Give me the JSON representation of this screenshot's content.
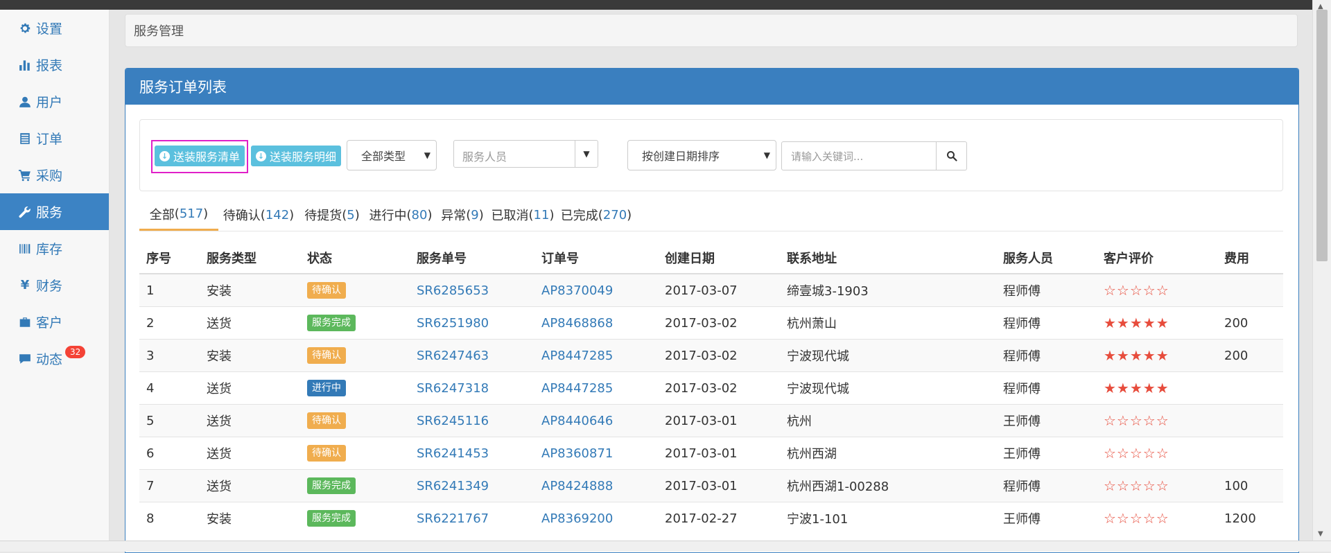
{
  "sidebar": {
    "items": [
      {
        "label": "设置",
        "icon": "gear-icon"
      },
      {
        "label": "报表",
        "icon": "bar-chart-icon"
      },
      {
        "label": "用户",
        "icon": "user-icon"
      },
      {
        "label": "订单",
        "icon": "list-icon"
      },
      {
        "label": "采购",
        "icon": "cart-icon"
      },
      {
        "label": "服务",
        "icon": "wrench-icon",
        "active": true
      },
      {
        "label": "库存",
        "icon": "barcode-icon"
      },
      {
        "label": "财务",
        "icon": "yen-icon"
      },
      {
        "label": "客户",
        "icon": "briefcase-icon"
      },
      {
        "label": "动态",
        "icon": "comment-icon",
        "badge": "32"
      }
    ]
  },
  "breadcrumb": {
    "text": "服务管理"
  },
  "panel": {
    "title": "服务订单列表"
  },
  "filters": {
    "btn_service_list": "送装服务清单",
    "btn_service_detail": "送装服务明细",
    "type_select": "全部类型",
    "staff_placeholder": "服务人员",
    "sort_select": "按创建日期排序",
    "keyword_placeholder": "请输入关键词..."
  },
  "tabs": [
    {
      "label": "全部",
      "count": "517",
      "active": true
    },
    {
      "label": "待确认",
      "count": "142"
    },
    {
      "label": "待提货",
      "count": "5"
    },
    {
      "label": "进行中",
      "count": "80"
    },
    {
      "label": "异常",
      "count": "9"
    },
    {
      "label": "已取消",
      "count": "11"
    },
    {
      "label": "已完成",
      "count": "270"
    }
  ],
  "table": {
    "headers": [
      "序号",
      "服务类型",
      "状态",
      "服务单号",
      "订单号",
      "创建日期",
      "联系地址",
      "服务人员",
      "客户评价",
      "费用"
    ],
    "rows": [
      {
        "no": "1",
        "type": "安装",
        "status": "待确认",
        "service_no": "SR6285653",
        "order_no": "AP8370049",
        "date": "2017-03-07",
        "address": "缔壹城3-1903",
        "staff": "程师傅",
        "rating": "☆☆☆☆☆",
        "fee": ""
      },
      {
        "no": "2",
        "type": "送货",
        "status": "服务完成",
        "service_no": "SR6251980",
        "order_no": "AP8468868",
        "date": "2017-03-02",
        "address": "杭州萧山",
        "staff": "程师傅",
        "rating": "★★★★★",
        "fee": "200"
      },
      {
        "no": "3",
        "type": "安装",
        "status": "待确认",
        "service_no": "SR6247463",
        "order_no": "AP8447285",
        "date": "2017-03-02",
        "address": "宁波现代城",
        "staff": "程师傅",
        "rating": "★★★★★",
        "fee": "200"
      },
      {
        "no": "4",
        "type": "送货",
        "status": "进行中",
        "service_no": "SR6247318",
        "order_no": "AP8447285",
        "date": "2017-03-02",
        "address": "宁波现代城",
        "staff": "程师傅",
        "rating": "★★★★★",
        "fee": ""
      },
      {
        "no": "5",
        "type": "送货",
        "status": "待确认",
        "service_no": "SR6245116",
        "order_no": "AP8440646",
        "date": "2017-03-01",
        "address": "杭州",
        "staff": "王师傅",
        "rating": "☆☆☆☆☆",
        "fee": ""
      },
      {
        "no": "6",
        "type": "送货",
        "status": "待确认",
        "service_no": "SR6241453",
        "order_no": "AP8360871",
        "date": "2017-03-01",
        "address": "杭州西湖",
        "staff": "王师傅",
        "rating": "☆☆☆☆☆",
        "fee": ""
      },
      {
        "no": "7",
        "type": "送货",
        "status": "服务完成",
        "service_no": "SR6241349",
        "order_no": "AP8424888",
        "date": "2017-03-01",
        "address": "杭州西湖1-00288",
        "staff": "程师傅",
        "rating": "☆☆☆☆☆",
        "fee": "100"
      },
      {
        "no": "8",
        "type": "安装",
        "status": "服务完成",
        "service_no": "SR6221767",
        "order_no": "AP8369200",
        "date": "2017-02-27",
        "address": "宁波1-101",
        "staff": "王师傅",
        "rating": "☆☆☆☆☆",
        "fee": "1200"
      }
    ]
  },
  "status_colors": {
    "待确认": "#f0ad4e",
    "服务完成": "#5cb85c",
    "进行中": "#337ab7"
  },
  "colors": {
    "primary": "#337ab7",
    "panel_header": "#3a7fbf",
    "tab_active_border": "#f0ad4e",
    "star": "#e74c3c",
    "info_button": "#5bc0de",
    "badge": "#f44336"
  }
}
